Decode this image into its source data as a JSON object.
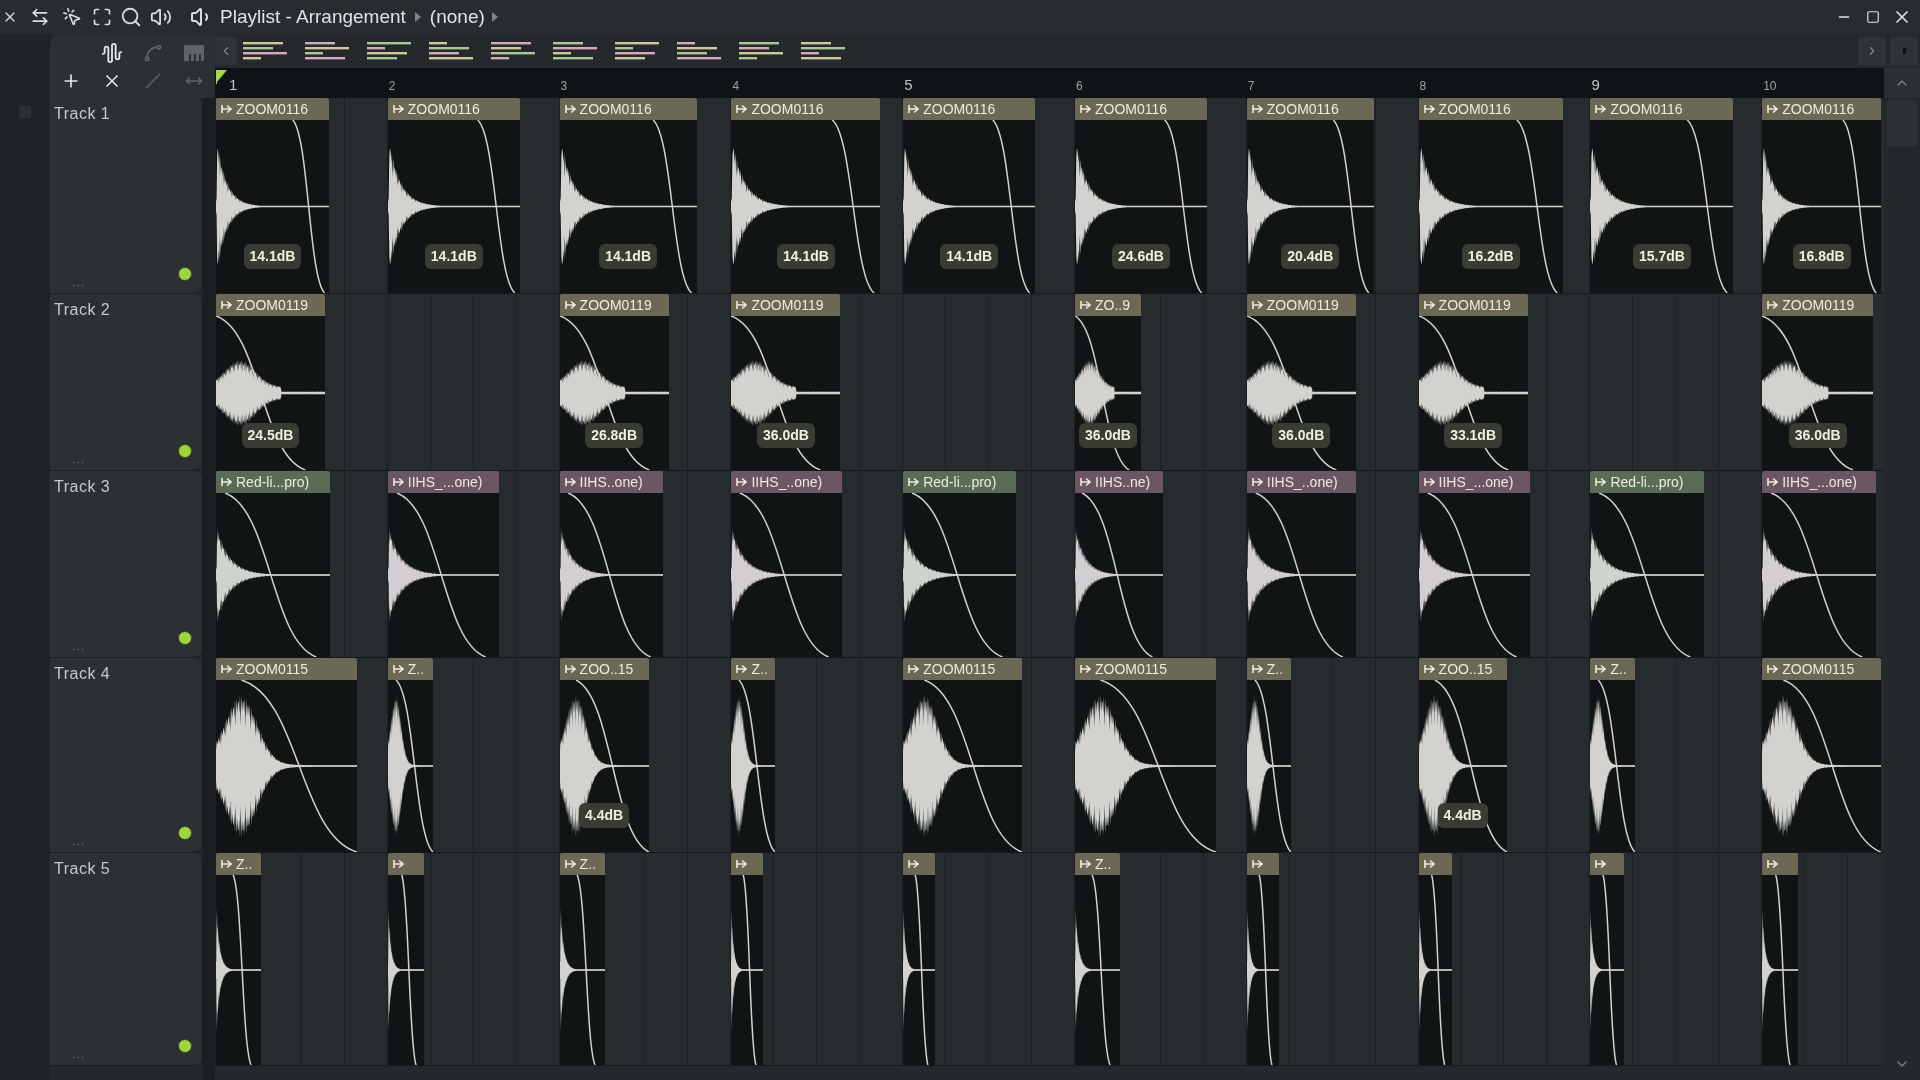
{
  "window": {
    "title": "Playlist - Arrangement",
    "pattern": "(none)"
  },
  "ruler": {
    "bars": [
      "1",
      "2",
      "3",
      "4",
      "5",
      "6",
      "7",
      "8",
      "9",
      "10"
    ]
  },
  "tracks": [
    {
      "name": "Track 1",
      "on": true,
      "clips": [
        {
          "kind": "clip",
          "name": "ZOOM0116",
          "gain": "14.1dB"
        },
        {
          "kind": "clip",
          "name": "ZOOM0116",
          "gain": "14.1dB"
        },
        {
          "kind": "clip",
          "name": "ZOOM0116",
          "gain": "14.1dB"
        },
        {
          "kind": "clip",
          "name": "ZOOM0116",
          "gain": "14.1dB"
        },
        {
          "kind": "clip",
          "name": "ZOOM0116",
          "gain": "14.1dB"
        },
        {
          "kind": "clip",
          "name": "ZOOM0116",
          "gain": "24.6dB"
        },
        {
          "kind": "clip",
          "name": "ZOOM0116",
          "gain": "20.4dB"
        },
        {
          "kind": "clip",
          "name": "ZOOM0116",
          "gain": "16.2dB"
        },
        {
          "kind": "clip",
          "name": "ZOOM0116",
          "gain": "15.7dB"
        },
        {
          "kind": "clip",
          "name": "ZOOM0116",
          "gain": "16.8dB"
        }
      ]
    },
    {
      "name": "Track 2",
      "on": true,
      "clips": [
        {
          "kind": "clip",
          "name": "ZOOM0119",
          "gain": "24.5dB"
        },
        {
          "kind": "empty"
        },
        {
          "kind": "clip",
          "name": "ZOOM0119",
          "gain": "26.8dB"
        },
        {
          "kind": "clip",
          "name": "ZOOM0119",
          "gain": "36.0dB"
        },
        {
          "kind": "empty"
        },
        {
          "kind": "clip",
          "name": "ZO..9",
          "gain": "36.0dB"
        },
        {
          "kind": "clip",
          "name": "ZOOM0119",
          "gain": "36.0dB"
        },
        {
          "kind": "clip",
          "name": "ZOOM0119",
          "gain": "33.1dB"
        },
        {
          "kind": "empty"
        },
        {
          "kind": "clip",
          "name": "ZOOM0119",
          "gain": "36.0dB"
        }
      ]
    },
    {
      "name": "Track 3",
      "on": true,
      "clips": [
        {
          "kind": "clip",
          "name": "Red-li...pro)",
          "color": "#5b6b55"
        },
        {
          "kind": "clip",
          "name": "IIHS_...one)",
          "color": "#6b5664"
        },
        {
          "kind": "clip",
          "name": "IIHS..one)",
          "color": "#6b5664"
        },
        {
          "kind": "clip",
          "name": "IIHS_..one)",
          "color": "#6b5664"
        },
        {
          "kind": "clip",
          "name": "Red-li...pro)",
          "color": "#5b6b55"
        },
        {
          "kind": "clip",
          "name": "IIHS..ne)",
          "color": "#6b5664"
        },
        {
          "kind": "clip",
          "name": "IIHS_..one)",
          "color": "#6b5664"
        },
        {
          "kind": "clip",
          "name": "IIHS_...one)",
          "color": "#6b5664"
        },
        {
          "kind": "clip",
          "name": "Red-li...pro)",
          "color": "#5b6b55"
        },
        {
          "kind": "clip",
          "name": "IIHS_...one)",
          "color": "#6b5664"
        }
      ]
    },
    {
      "name": "Track 4",
      "on": true,
      "clips": [
        {
          "kind": "clip",
          "name": "ZOOM0115"
        },
        {
          "kind": "clip",
          "name": "Z.."
        },
        {
          "kind": "clip",
          "name": "ZOO..15",
          "gain": "4.4dB"
        },
        {
          "kind": "clip",
          "name": "Z.."
        },
        {
          "kind": "clip",
          "name": "ZOOM0115"
        },
        {
          "kind": "clip",
          "name": "ZOOM0115"
        },
        {
          "kind": "clip",
          "name": "Z.."
        },
        {
          "kind": "clip",
          "name": "ZOO..15",
          "gain": "4.4dB"
        },
        {
          "kind": "clip",
          "name": "Z.."
        },
        {
          "kind": "clip",
          "name": "ZOOM0115"
        }
      ]
    },
    {
      "name": "Track 5",
      "on": true,
      "clips": [
        {
          "kind": "clip",
          "name": "Z.."
        },
        {
          "kind": "clip"
        },
        {
          "kind": "clip",
          "name": "Z.."
        },
        {
          "kind": "clip"
        },
        {
          "kind": "clip"
        },
        {
          "kind": "clip",
          "name": "Z.."
        },
        {
          "kind": "clip"
        },
        {
          "kind": "clip"
        },
        {
          "kind": "clip"
        },
        {
          "kind": "clip"
        }
      ]
    }
  ]
}
